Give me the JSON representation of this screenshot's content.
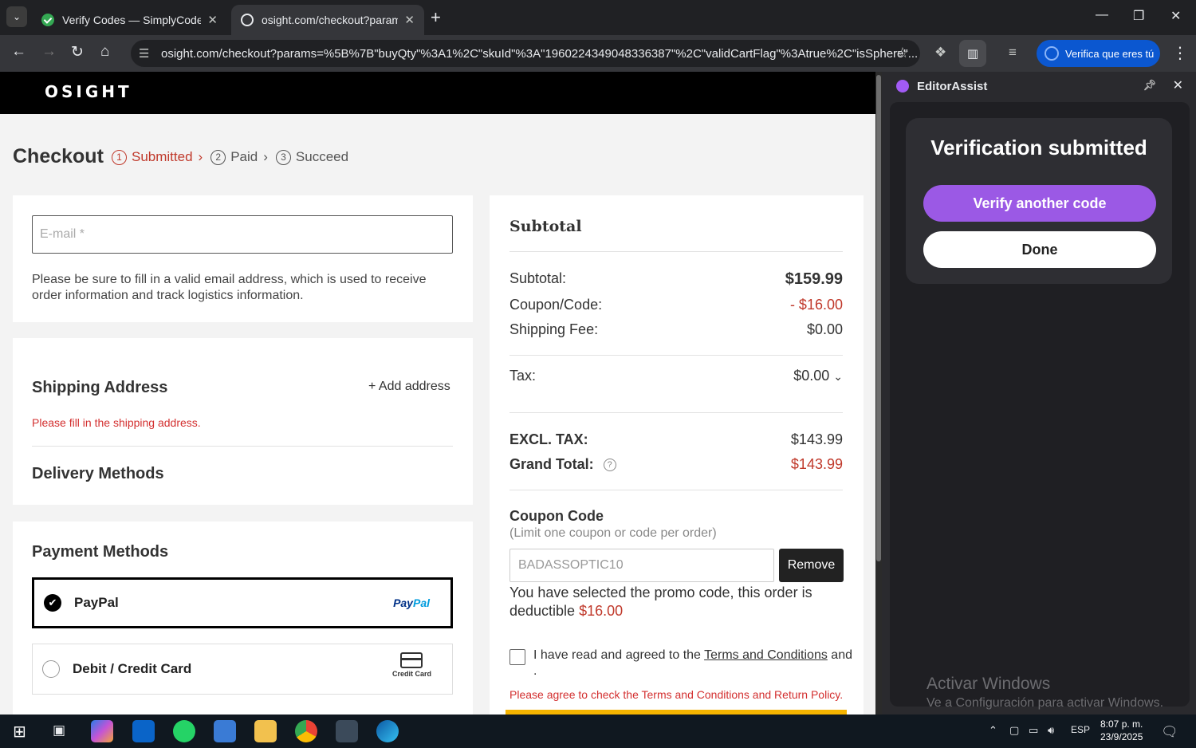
{
  "browser": {
    "tabs": [
      {
        "title": "Verify Codes — SimplyCodes",
        "active": false
      },
      {
        "title": "osight.com/checkout?params=%",
        "active": true
      }
    ],
    "url": "osight.com/checkout?params=%5B%7B\"buyQty\"%3A1%2C\"skuId\"%3A\"1960224349048336387\"%2C\"validCartFlag\"%3Atrue%2C\"isSphere\"...",
    "verify_pill": "Verifica que eres tú"
  },
  "site": {
    "logo": "OSIGHT",
    "checkout_title": "Checkout",
    "steps": [
      {
        "num": "1",
        "label": "Submitted"
      },
      {
        "num": "2",
        "label": "Paid"
      },
      {
        "num": "3",
        "label": "Succeed"
      }
    ],
    "email": {
      "placeholder": "E-mail *",
      "help": "Please be sure to fill in a valid email address, which is used to receive order information and track logistics information."
    },
    "shipping": {
      "title": "Shipping Address",
      "add_address": "+ Add address",
      "warning": "Please fill in the shipping address."
    },
    "delivery": {
      "title": "Delivery Methods"
    },
    "payment": {
      "title": "Payment Methods",
      "options": [
        {
          "label": "PayPal",
          "logo": "PayPal",
          "selected": true
        },
        {
          "label": "Debit / Credit Card",
          "logo": "Credit Card",
          "selected": false
        }
      ]
    },
    "summary": {
      "title": "Subtotal",
      "subtotal_label": "Subtotal:",
      "subtotal_value": "$159.99",
      "coupon_label": "Coupon/Code:",
      "coupon_value": "- $16.00",
      "shipping_label": "Shipping Fee:",
      "shipping_value": "$0.00",
      "tax_label": "Tax:",
      "tax_value": "$0.00",
      "excl_label": "EXCL. TAX:",
      "excl_value": "$143.99",
      "grand_label": "Grand Total:",
      "grand_value": "$143.99",
      "coupon_title": "Coupon Code",
      "coupon_limit": "(Limit one coupon or code per order)",
      "coupon_code": "BADASSOPTIC10",
      "remove_label": "Remove",
      "promo_note": "You have selected the promo code, this order is deductible",
      "promo_amount": "$16.00",
      "terms_prefix": "I have read and agreed to the",
      "terms_link": "Terms and Conditions",
      "terms_suffix": "and",
      "terms_end": ".",
      "terms_warning": "Please agree to check the Terms and Conditions and Return Policy."
    }
  },
  "sidepanel": {
    "title": "EditorAssist",
    "heading": "Verification submitted",
    "verify_again": "Verify another code",
    "done": "Done",
    "activate_title": "Activar Windows",
    "activate_sub": "Ve a Configuración para activar Windows."
  },
  "taskbar": {
    "lang": "ESP",
    "time": "8:07 p. m.",
    "date": "23/9/2025"
  },
  "colors": {
    "accent_red": "#c0392b",
    "brand_purple": "#9b59e5",
    "chrome_blue": "#0b57d0"
  }
}
